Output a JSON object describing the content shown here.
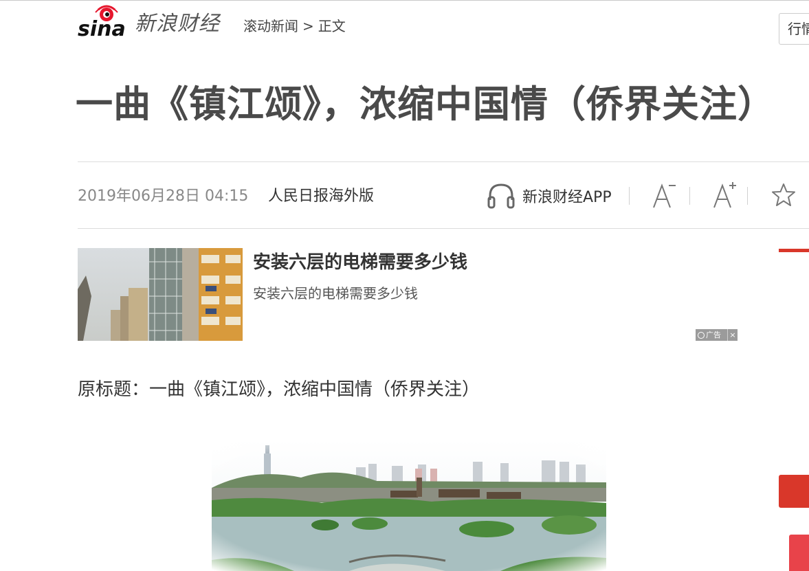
{
  "header": {
    "brand_name": "新浪财经",
    "breadcrumb": {
      "section": "滚动新闻",
      "separator": ">",
      "current": "正文"
    },
    "market_button": "行情"
  },
  "article": {
    "title": "一曲《镇江颂》，浓缩中国情（侨界关注）",
    "date": "2019年06月28日 04:15",
    "source": "人民日报海外版",
    "app_link": "新浪财经APP",
    "original_title": "原标题：一曲《镇江颂》，浓缩中国情（侨界关注）"
  },
  "ad": {
    "title": "安装六层的电梯需要多少钱",
    "description": "安装六层的电梯需要多少钱",
    "badge": "广告",
    "close": "×"
  },
  "toolbar": {
    "icons": [
      "headphones-icon",
      "font-decrease-icon",
      "font-increase-icon",
      "star-icon"
    ]
  },
  "colors": {
    "accent_red": "#d9372a",
    "sina_red": "#e6162d",
    "title": "#4a4a4a",
    "meta_gray": "#888888"
  }
}
